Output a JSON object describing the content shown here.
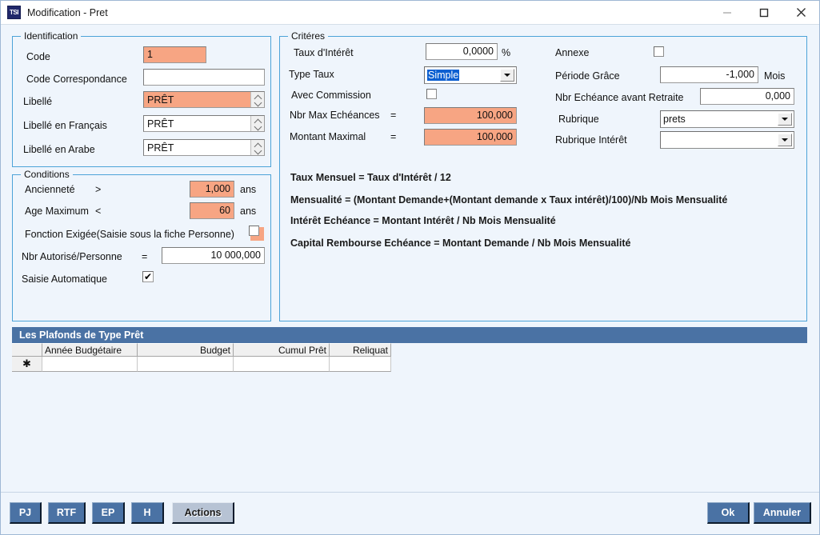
{
  "window": {
    "title": "Modification - Pret",
    "app_icon": "TSI",
    "controls": {
      "minimize": "minimize-icon",
      "maximize": "maximize-icon",
      "close": "close-icon"
    }
  },
  "identification": {
    "legend": "Identification",
    "fields": {
      "code": {
        "label": "Code",
        "value": "1"
      },
      "code_correspondance": {
        "label": "Code Correspondance",
        "value": ""
      },
      "libelle": {
        "label": "Libellé",
        "value": "PRÊT"
      },
      "libelle_fr": {
        "label": "Libellé en Français",
        "value": "PRÊT"
      },
      "libelle_ar": {
        "label": "Libellé en Arabe",
        "value": "PRÊT"
      }
    }
  },
  "conditions": {
    "legend": "Conditions",
    "anciennete": {
      "label": "Ancienneté",
      "operator": ">",
      "value": "1,000",
      "unit": "ans"
    },
    "age_maximum": {
      "label": "Age Maximum",
      "operator": "<",
      "value": "60",
      "unit": "ans"
    },
    "fonction_exigee": {
      "label": "Fonction Exigée(Saisie sous la fiche Personne)",
      "checked": false
    },
    "nbr_autorise": {
      "label": "Nbr Autorisé/Personne",
      "operator": "=",
      "value": "10 000,000"
    },
    "saisie_automatique": {
      "label": "Saisie Automatique",
      "checked": true,
      "check_glyph": "✔"
    }
  },
  "criteres": {
    "legend": "Critéres",
    "taux_interet": {
      "label": "Taux d'Intérêt",
      "value": "0,0000",
      "unit": "%"
    },
    "type_taux": {
      "label": "Type Taux",
      "value": "Simple",
      "options": [
        "Simple"
      ]
    },
    "avec_commission": {
      "label": "Avec Commission",
      "checked": false
    },
    "nbr_max_echeances": {
      "label": "Nbr Max Echéances",
      "operator": "=",
      "value": "100,000"
    },
    "montant_maximal": {
      "label": "Montant Maximal",
      "operator": "=",
      "value": "100,000"
    },
    "annexe": {
      "label": "Annexe",
      "checked": false
    },
    "periode_grace": {
      "label": "Période Grâce",
      "value": "-1,000",
      "unit": "Mois"
    },
    "nbr_echeance_retraite": {
      "label": "Nbr Echéance avant Retraite",
      "value": "0,000"
    },
    "rubrique": {
      "label": "Rubrique",
      "value": "prets",
      "options": [
        "prets"
      ]
    },
    "rubrique_interet": {
      "label": "Rubrique Intérêt",
      "value": "",
      "options": []
    },
    "formulas": [
      "Taux Mensuel = Taux d'Intérêt / 12",
      "Mensualité = (Montant Demande+(Montant demande x Taux intérêt)/100)/Nb Mois Mensualité",
      "Intérêt Echéance = Montant Intérêt / Nb Mois Mensualité",
      "Capital Rembourse Echéance = Montant Demande / Nb Mois Mensualité"
    ]
  },
  "grid": {
    "title": "Les Plafonds de Type Prêt",
    "columns": [
      "",
      "Année Budgétaire",
      "Budget",
      "Cumul Prêt",
      "Reliquat"
    ],
    "new_row_marker": "✱",
    "rows": []
  },
  "toolbar": {
    "pj": "PJ",
    "rtf": "RTF",
    "ep": "EP",
    "h": "H",
    "actions": "Actions",
    "ok": "Ok",
    "annuler": "Annuler"
  },
  "colors": {
    "accent_blue": "#4a72a4",
    "highlight_orange": "#f7a583",
    "group_border": "#4da3d8",
    "background": "#eff5fc",
    "selection_blue": "#0b5fd1"
  }
}
